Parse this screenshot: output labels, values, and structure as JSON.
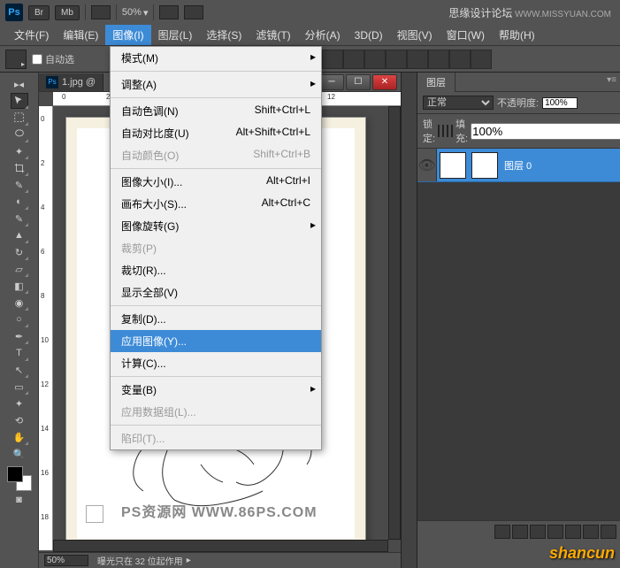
{
  "top": {
    "zoom": "50%",
    "site_name": "思缘设计论坛",
    "site_url": "WWW.MISSYUAN.COM"
  },
  "menu": {
    "file": "文件(F)",
    "edit": "编辑(E)",
    "image": "图像(I)",
    "layer": "图层(L)",
    "select": "选择(S)",
    "filter": "滤镜(T)",
    "analysis": "分析(A)",
    "threed": "3D(D)",
    "view": "视图(V)",
    "window": "窗口(W)",
    "help": "帮助(H)"
  },
  "opt": {
    "autoselect": "自动选"
  },
  "tab": {
    "name": "1.jpg @"
  },
  "dropdown": {
    "mode": "模式(M)",
    "adjust": "调整(A)",
    "autotone": "自动色调(N)",
    "autotone_sc": "Shift+Ctrl+L",
    "autocontrast": "自动对比度(U)",
    "autocontrast_sc": "Alt+Shift+Ctrl+L",
    "autocolor": "自动颜色(O)",
    "autocolor_sc": "Shift+Ctrl+B",
    "imagesize": "图像大小(I)...",
    "imagesize_sc": "Alt+Ctrl+I",
    "canvassize": "画布大小(S)...",
    "canvassize_sc": "Alt+Ctrl+C",
    "rotation": "图像旋转(G)",
    "crop": "裁剪(P)",
    "trim": "裁切(R)...",
    "reveal": "显示全部(V)",
    "duplicate": "复制(D)...",
    "apply": "应用图像(Y)...",
    "calc": "计算(C)...",
    "vars": "变量(B)",
    "applydata": "应用数据组(L)...",
    "trap": "陷印(T)..."
  },
  "status": {
    "zoom": "50%",
    "info": "曝光只在 32 位起作用"
  },
  "layers": {
    "title": "图层",
    "blend": "正常",
    "opacity_lbl": "不透明度:",
    "opacity": "100%",
    "lock_lbl": "锁定:",
    "fill_lbl": "填充:",
    "fill": "100%",
    "layer0": "图层 0"
  },
  "watermark": "PS资源网  WWW.86PS.COM",
  "brand": "shancun"
}
